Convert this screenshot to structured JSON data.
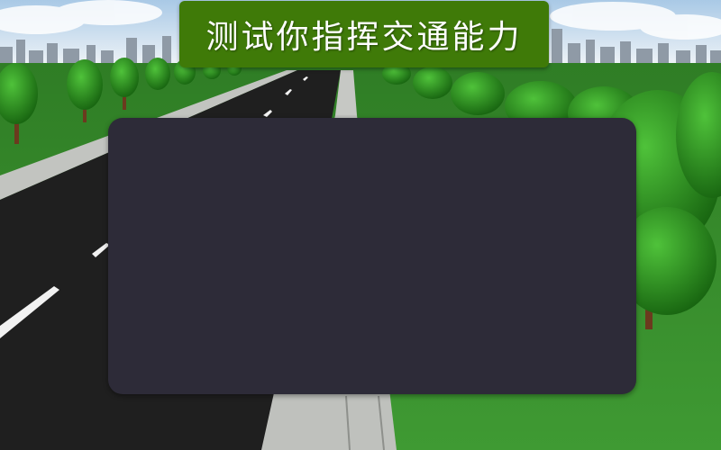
{
  "header": {
    "title": "测试你指挥交通能力"
  },
  "scene": {
    "sky_color": "#cfe3f2",
    "grass_color": "#3a8a2e",
    "road_color": "#1e1e1e",
    "sidewalk_color": "#b8bab6",
    "lane_mark_color": "#f0f0f0",
    "tree_color": "#2a8a1a",
    "trunk_color": "#6b3a1e"
  },
  "colors": {
    "banner": "#3f7a08",
    "panel": "#2d2b38"
  }
}
